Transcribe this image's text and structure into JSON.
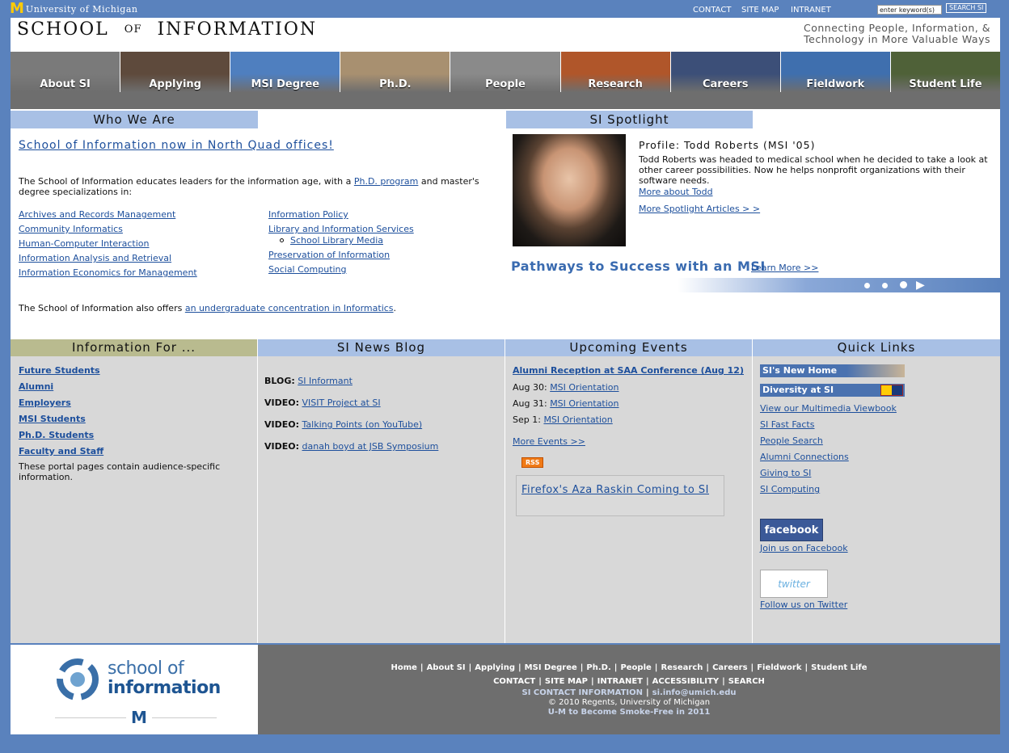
{
  "topbar": {
    "um_m": "M",
    "um_name": "University of Michigan",
    "links": [
      "CONTACT",
      "SITE MAP",
      "INTRANET"
    ],
    "search_placeholder": "enter keyword(s)",
    "search_button": "SEARCH SI"
  },
  "header": {
    "title_a": "SCHOOL",
    "title_of": "OF",
    "title_b": "INFORMATION",
    "tagline_1": "Connecting People, Information, &",
    "tagline_2": "Technology in More Valuable Ways"
  },
  "nav": {
    "tabs": [
      {
        "label": "About SI",
        "bg": "#7a7a7a"
      },
      {
        "label": "Applying",
        "bg": "#5e4a3c"
      },
      {
        "label": "MSI Degree",
        "bg": "#4f7fbf"
      },
      {
        "label": "Ph.D.",
        "bg": "#a89070"
      },
      {
        "label": "People",
        "bg": "#8a8a8a"
      },
      {
        "label": "Research",
        "bg": "#b0562a"
      },
      {
        "label": "Careers",
        "bg": "#3c4f78"
      },
      {
        "label": "Fieldwork",
        "bg": "#3f6fae"
      },
      {
        "label": "Student Life",
        "bg": "#4f6138"
      }
    ]
  },
  "who": {
    "heading": "Who We Are",
    "headline": "School of Information now in North Quad offices!",
    "intro_pre": "The School of Information educates leaders for the information age, with a ",
    "intro_link": "Ph.D. program",
    "intro_post": " and master's degree specializations in:",
    "specs_left": [
      "Archives and Records Management",
      "Community Informatics",
      "Human-Computer Interaction",
      "Information Analysis and Retrieval",
      "Information Economics for Management"
    ],
    "specs_right": [
      "Information Policy",
      "Library and Information Services",
      "School Library Media",
      "Preservation of Information",
      "Social Computing"
    ],
    "undergrad_pre": "The School of Information also offers ",
    "undergrad_link": "an undergraduate concentration in Informatics",
    "undergrad_post": "."
  },
  "spotlight": {
    "heading": "SI Spotlight",
    "profile_title": "Profile: Todd Roberts (MSI '05)",
    "profile_text": "Todd Roberts was headed to medical school when he decided to take a look at other career possibilities. Now he helps nonprofit organizations with their software needs.",
    "more_todd": "More about Todd",
    "more_articles": "More Spotlight Articles > >",
    "pathways": "Pathways to Success with an MSI",
    "learn_more": "Learn More >>",
    "next_arrow": "▶"
  },
  "info_for": {
    "heading": "Information For ...",
    "links": [
      "Future Students",
      "Alumni",
      "Employers",
      "MSI Students",
      "Ph.D. Students",
      "Faculty and Staff"
    ],
    "note": "These portal pages contain audience-specific information."
  },
  "news": {
    "heading": "SI News Blog",
    "items": [
      {
        "kind": "BLOG:",
        "title": "SI Informant"
      },
      {
        "kind": "VIDEO:",
        "title": "VISIT Project at SI"
      },
      {
        "kind": "VIDEO:",
        "title": "Talking Points (on YouTube)"
      },
      {
        "kind": "VIDEO:",
        "title": "danah boyd at JSB Symposium"
      }
    ]
  },
  "events": {
    "heading": "Upcoming Events",
    "featured": "Alumni Reception at SAA Conference (Aug 12)",
    "items": [
      {
        "date": "Aug 30:",
        "title": "MSI Orientation"
      },
      {
        "date": "Aug 31:",
        "title": "MSI Orientation"
      },
      {
        "date": "Sep 1:",
        "title": "MSI Orientation"
      }
    ],
    "more": "More Events >>",
    "rss": "RSS",
    "feature_box": "Firefox's Aza Raskin Coming to SI"
  },
  "quick": {
    "heading": "Quick Links",
    "banner_home": "SI's New Home",
    "banner_diversity": "Diversity at SI",
    "links": [
      "View our Multimedia Viewbook",
      "SI Fast Facts",
      "People Search",
      "Alumni Connections",
      "Giving to SI",
      "SI Computing"
    ],
    "facebook_badge": "facebook",
    "facebook_link": "Join us on Facebook",
    "twitter_badge": "twitter",
    "twitter_link": "Follow us on Twitter"
  },
  "footer": {
    "logo_line1": "school of",
    "logo_line2": "information",
    "logo_m": "M",
    "row1": [
      "Home",
      "About SI",
      "Applying",
      "MSI Degree",
      "Ph.D.",
      "People",
      "Research",
      "Careers",
      "Fieldwork",
      "Student Life"
    ],
    "row2": [
      "CONTACT",
      "SITE MAP",
      "INTRANET",
      "ACCESSIBILITY",
      "SEARCH"
    ],
    "contact_label": "SI CONTACT INFORMATION",
    "contact_email": "si.info@umich.edu",
    "copyright": "© 2010 Regents, University of Michigan",
    "smoke_free": "U-M to Become Smoke-Free in 2011"
  },
  "colors": {
    "page_bg": "#5a82bd",
    "tab_blue": "#a8c0e5",
    "tab_olive": "#b9bb8f",
    "link": "#1d4f9c",
    "maize": "#ffcb05"
  }
}
